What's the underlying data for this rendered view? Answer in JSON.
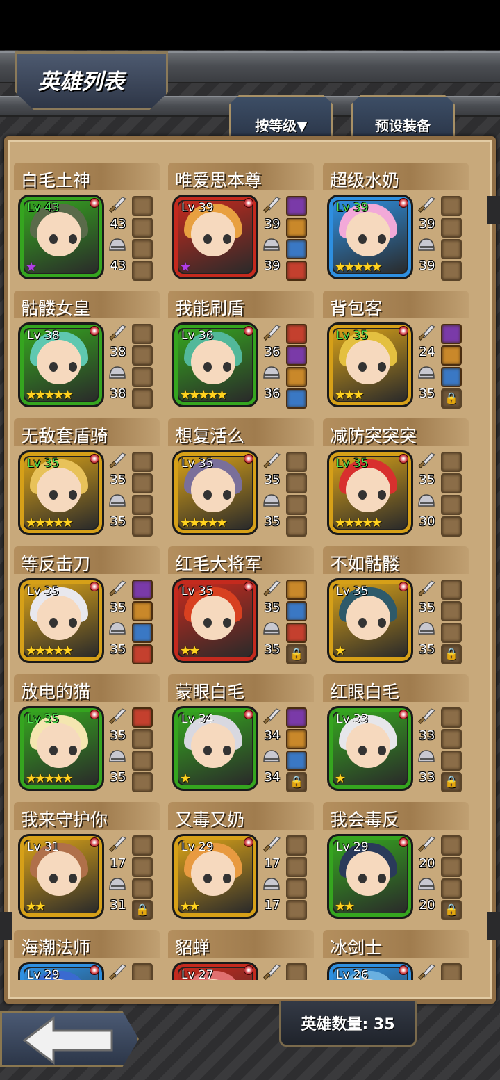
{
  "screen_title": "英雄列表",
  "tabs": [
    {
      "label": "按等级▼"
    },
    {
      "label": "预设装备"
    }
  ],
  "hero_count_text": "英雄数量: 35",
  "colors": {
    "frame_green": "#35a51f",
    "frame_red": "#c42a1e",
    "frame_gold": "#d6a018",
    "frame_blue": "#2e8fe0",
    "star_gold": "#ffd21f",
    "star_purple": "#b13ee6",
    "panel": "#c8a97b"
  },
  "heroes": [
    {
      "name": "白毛土神",
      "level": "Lv 43",
      "lv_green": true,
      "frame": "green",
      "stars": "★",
      "star_color": "purple",
      "attack": "43",
      "defense": "43",
      "slots": [
        "empty",
        "empty",
        "empty",
        "empty"
      ],
      "hair": "#5a6b4a"
    },
    {
      "name": "唯爱思本尊",
      "level": "Lv 39",
      "lv_green": false,
      "frame": "red",
      "stars": "★",
      "star_color": "purple",
      "attack": "39",
      "defense": "39",
      "slots": [
        "filled",
        "filled",
        "filled",
        "filled"
      ],
      "hair": "#e8a040"
    },
    {
      "name": "超级水奶",
      "level": "Lv 39",
      "lv_green": true,
      "frame": "blue",
      "stars": "★★★★★",
      "star_color": "gold",
      "attack": "39",
      "defense": "39",
      "slots": [
        "empty",
        "empty",
        "empty",
        "empty"
      ],
      "hair": "#f2a9d8"
    },
    {
      "name": "骷髅女皇",
      "level": "Lv 38",
      "lv_green": false,
      "frame": "green",
      "stars": "★★★★★",
      "star_color": "gold",
      "attack": "38",
      "defense": "38",
      "slots": [
        "empty",
        "empty",
        "empty",
        "empty"
      ],
      "hair": "#5fc8b0"
    },
    {
      "name": "我能刷盾",
      "level": "Lv 36",
      "lv_green": false,
      "frame": "green",
      "stars": "★★★★★",
      "star_color": "gold",
      "attack": "36",
      "defense": "36",
      "slots": [
        "filled",
        "filled",
        "filled",
        "filled"
      ],
      "hair": "#52b89a"
    },
    {
      "name": "背包客",
      "level": "Lv 35",
      "lv_green": true,
      "frame": "gold",
      "stars": "★★★",
      "star_color": "gold",
      "attack": "24",
      "defense": "35",
      "slots": [
        "filled",
        "filled",
        "filled",
        "lock"
      ],
      "hair": "#e4c040"
    },
    {
      "name": "无敌套盾骑",
      "level": "Lv 35",
      "lv_green": true,
      "frame": "gold",
      "stars": "★★★★★",
      "star_color": "gold",
      "attack": "35",
      "defense": "35",
      "slots": [
        "empty",
        "empty",
        "empty",
        "empty"
      ],
      "hair": "#e8c25a"
    },
    {
      "name": "想复活么",
      "level": "Lv 35",
      "lv_green": false,
      "frame": "gold",
      "stars": "★★★★★",
      "star_color": "gold",
      "attack": "35",
      "defense": "35",
      "slots": [
        "empty",
        "empty",
        "empty",
        "empty"
      ],
      "hair": "#7a6f9a"
    },
    {
      "name": "减防突突突",
      "level": "Lv 35",
      "lv_green": true,
      "frame": "gold",
      "stars": "★★★★★",
      "star_color": "gold",
      "attack": "35",
      "defense": "30",
      "slots": [
        "empty",
        "empty",
        "empty",
        "empty"
      ],
      "hair": "#d8302e"
    },
    {
      "name": "等反击刀",
      "level": "Lv 35",
      "lv_green": false,
      "frame": "gold",
      "stars": "★★★★★",
      "star_color": "gold",
      "attack": "35",
      "defense": "35",
      "slots": [
        "filled",
        "filled",
        "filled",
        "filled"
      ],
      "hair": "#e8e8ee"
    },
    {
      "name": "红毛大将军",
      "level": "Lv 35",
      "lv_green": false,
      "frame": "red",
      "stars": "★★",
      "star_color": "gold",
      "attack": "35",
      "defense": "35",
      "slots": [
        "filled",
        "filled",
        "filled",
        "lock"
      ],
      "hair": "#d84020"
    },
    {
      "name": "不如骷髅",
      "level": "Lv 35",
      "lv_green": false,
      "frame": "gold",
      "stars": "★",
      "star_color": "gold",
      "attack": "35",
      "defense": "35",
      "slots": [
        "empty",
        "empty",
        "empty",
        "lock"
      ],
      "hair": "#2e5a6a"
    },
    {
      "name": "放电的猫",
      "level": "Lv 35",
      "lv_green": true,
      "frame": "green",
      "stars": "★★★★★",
      "star_color": "gold",
      "attack": "35",
      "defense": "35",
      "slots": [
        "filled",
        "empty",
        "empty",
        "empty"
      ],
      "hair": "#f4e6b0"
    },
    {
      "name": "蒙眼白毛",
      "level": "Lv 34",
      "lv_green": false,
      "frame": "green",
      "stars": "★",
      "star_color": "gold",
      "attack": "34",
      "defense": "34",
      "slots": [
        "filled",
        "filled",
        "filled",
        "lock"
      ],
      "hair": "#d8d8e0"
    },
    {
      "name": "红眼白毛",
      "level": "Lv 33",
      "lv_green": false,
      "frame": "green",
      "stars": "★",
      "star_color": "gold",
      "attack": "33",
      "defense": "33",
      "slots": [
        "empty",
        "empty",
        "empty",
        "lock"
      ],
      "hair": "#e6e6ea"
    },
    {
      "name": "我来守护你",
      "level": "Lv 31",
      "lv_green": false,
      "frame": "gold",
      "stars": "★★",
      "star_color": "gold",
      "attack": "17",
      "defense": "31",
      "slots": [
        "empty",
        "empty",
        "empty",
        "lock"
      ],
      "hair": "#b0704a"
    },
    {
      "name": "又毒又奶",
      "level": "Lv 29",
      "lv_green": false,
      "frame": "gold",
      "stars": "★★",
      "star_color": "gold",
      "attack": "17",
      "defense": "17",
      "slots": [
        "empty",
        "empty",
        "empty",
        "empty"
      ],
      "hair": "#e89a40"
    },
    {
      "name": "我会毒反",
      "level": "Lv 29",
      "lv_green": false,
      "frame": "green",
      "stars": "★★",
      "star_color": "gold",
      "attack": "20",
      "defense": "20",
      "slots": [
        "empty",
        "empty",
        "empty",
        "lock"
      ],
      "hair": "#2a3a5a"
    },
    {
      "name": "海潮法师",
      "level": "Lv 29",
      "lv_green": false,
      "frame": "blue",
      "stars": "",
      "star_color": "gold",
      "attack": "",
      "defense": "",
      "slots": [
        "empty",
        "empty",
        "empty",
        "empty"
      ],
      "hair": "#3a6ad0"
    },
    {
      "name": "貂蝉",
      "level": "Lv 27",
      "lv_green": false,
      "frame": "red",
      "stars": "",
      "star_color": "gold",
      "attack": "",
      "defense": "",
      "slots": [
        "empty",
        "empty",
        "empty",
        "empty"
      ],
      "hair": "#e07070"
    },
    {
      "name": "冰剑士",
      "level": "Lv 26",
      "lv_green": false,
      "frame": "blue",
      "stars": "",
      "star_color": "gold",
      "attack": "",
      "defense": "",
      "slots": [
        "empty",
        "empty",
        "empty",
        "empty"
      ],
      "hair": "#6ab0e0"
    }
  ],
  "slot_item_colors": [
    "#c4402e",
    "#7a3aa8",
    "#c9882a",
    "#3a78c4"
  ]
}
